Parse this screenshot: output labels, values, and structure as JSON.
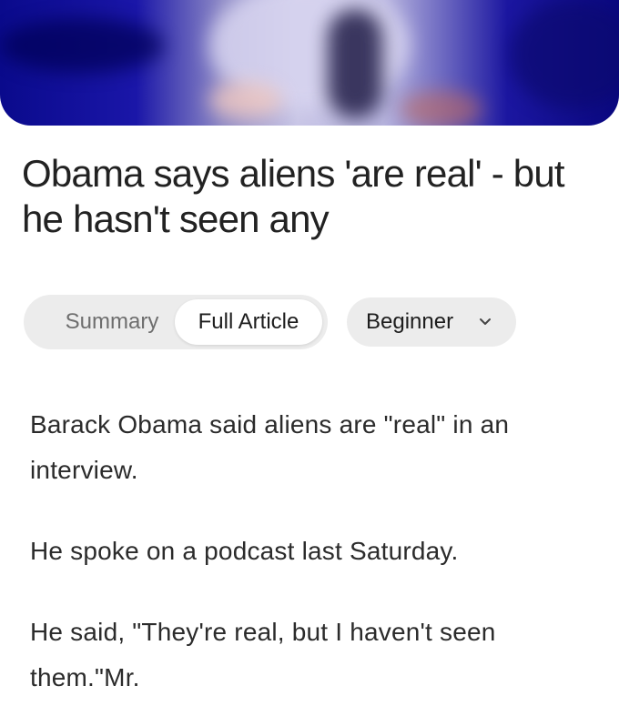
{
  "article": {
    "title": "Obama says aliens 'are real' - but he hasn't seen any",
    "paragraphs": [
      "Barack Obama said aliens are \"real\" in an interview.",
      "He spoke on a podcast last Saturday.",
      "He said, \"They're real, but I haven't seen them.\"Mr."
    ]
  },
  "view_toggle": {
    "options": [
      "Summary",
      "Full Article"
    ],
    "selected": "Full Article"
  },
  "level_select": {
    "value": "Beginner",
    "icon": "chevron-down-icon"
  }
}
